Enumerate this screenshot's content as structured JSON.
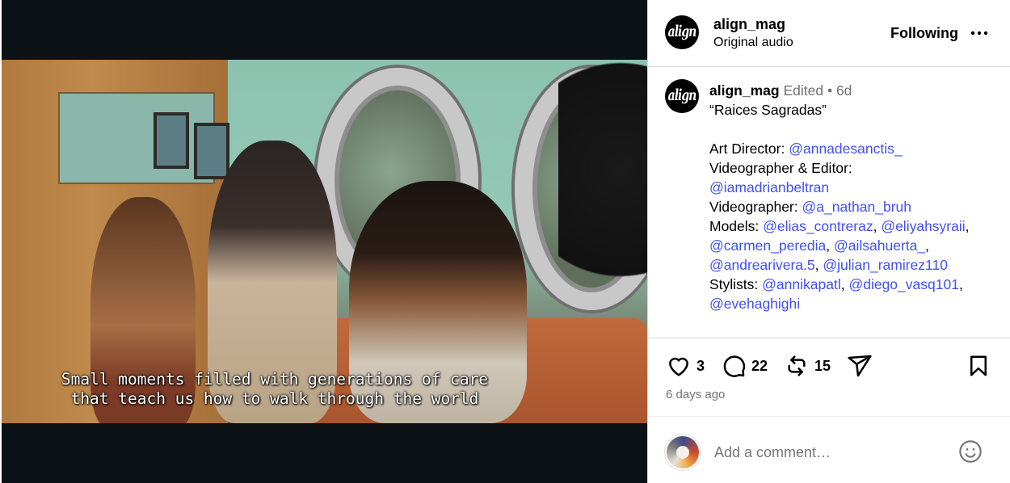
{
  "video": {
    "subtitle_lines": [
      "Small moments filled with generations of care",
      "that teach us how to walk through the world"
    ]
  },
  "header": {
    "username": "align_mag",
    "audio": "Original audio",
    "following_label": "Following",
    "more_label": "•••",
    "avatar_text": "align"
  },
  "caption": {
    "username": "align_mag",
    "edited": "Edited",
    "dot": "•",
    "age": "6d",
    "title": "“Raices Sagradas”",
    "art_director_label": "Art Director: ",
    "art_director": "@annadesanctis_",
    "videographer_editor_label": "Videographer & Editor:",
    "videographer_editor": "@iamadrianbeltran",
    "videographer_label": "Videographer: ",
    "videographer": "@a_nathan_bruh",
    "models_label": "Models: ",
    "models": [
      "@elias_contreraz",
      "@eliyahsyraii",
      "@carmen_peredia",
      "@ailsahuerta_",
      "@andrearivera.5",
      "@julian_ramirez110"
    ],
    "stylists_label": "Stylists: ",
    "stylists": [
      "@annikapatl",
      "@diego_vasq101",
      "@evehaghighi"
    ],
    "sep": ", ",
    "trail_comma": ","
  },
  "actions": {
    "likes": "3",
    "comments": "22",
    "reposts": "15",
    "time_ago": "6 days ago"
  },
  "comment": {
    "placeholder": "Add a comment…"
  },
  "colors": {
    "mention": "#4150f7",
    "muted": "#737373",
    "divider": "#dbdbdb"
  }
}
